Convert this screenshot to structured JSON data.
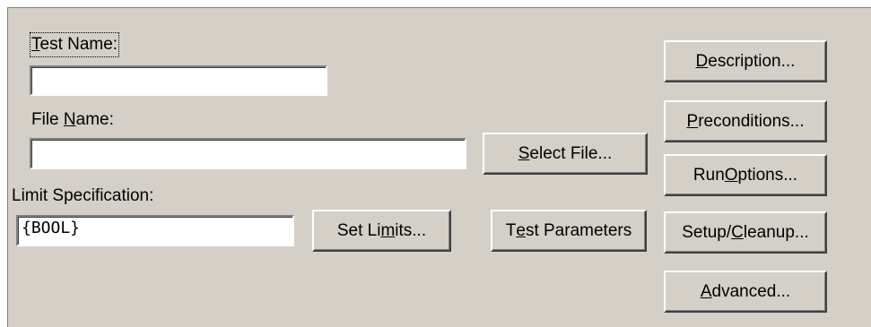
{
  "form": {
    "test_name": {
      "pre": "",
      "accel": "T",
      "post": "est Name:",
      "value": ""
    },
    "file_name": {
      "pre": "File ",
      "accel": "N",
      "post": "ame:",
      "value": ""
    },
    "limit_spec": {
      "label": "Limit Specification:",
      "value": "{BOOL}"
    }
  },
  "buttons": {
    "select_file": {
      "pre": "",
      "accel": "S",
      "post": "elect File..."
    },
    "set_limits": {
      "pre": "Set Li",
      "accel": "m",
      "post": "its..."
    },
    "test_parameters": {
      "pre": "T",
      "accel": "e",
      "post": "st Parameters"
    },
    "description": {
      "pre": "",
      "accel": "D",
      "post": "escription..."
    },
    "preconditions": {
      "pre": "",
      "accel": "P",
      "post": "reconditions..."
    },
    "run_options": {
      "pre": "Run ",
      "accel": "O",
      "post": "ptions..."
    },
    "setup_cleanup": {
      "pre": "Setup/",
      "accel": "C",
      "post": "leanup..."
    },
    "advanced": {
      "pre": "",
      "accel": "A",
      "post": "dvanced..."
    }
  }
}
